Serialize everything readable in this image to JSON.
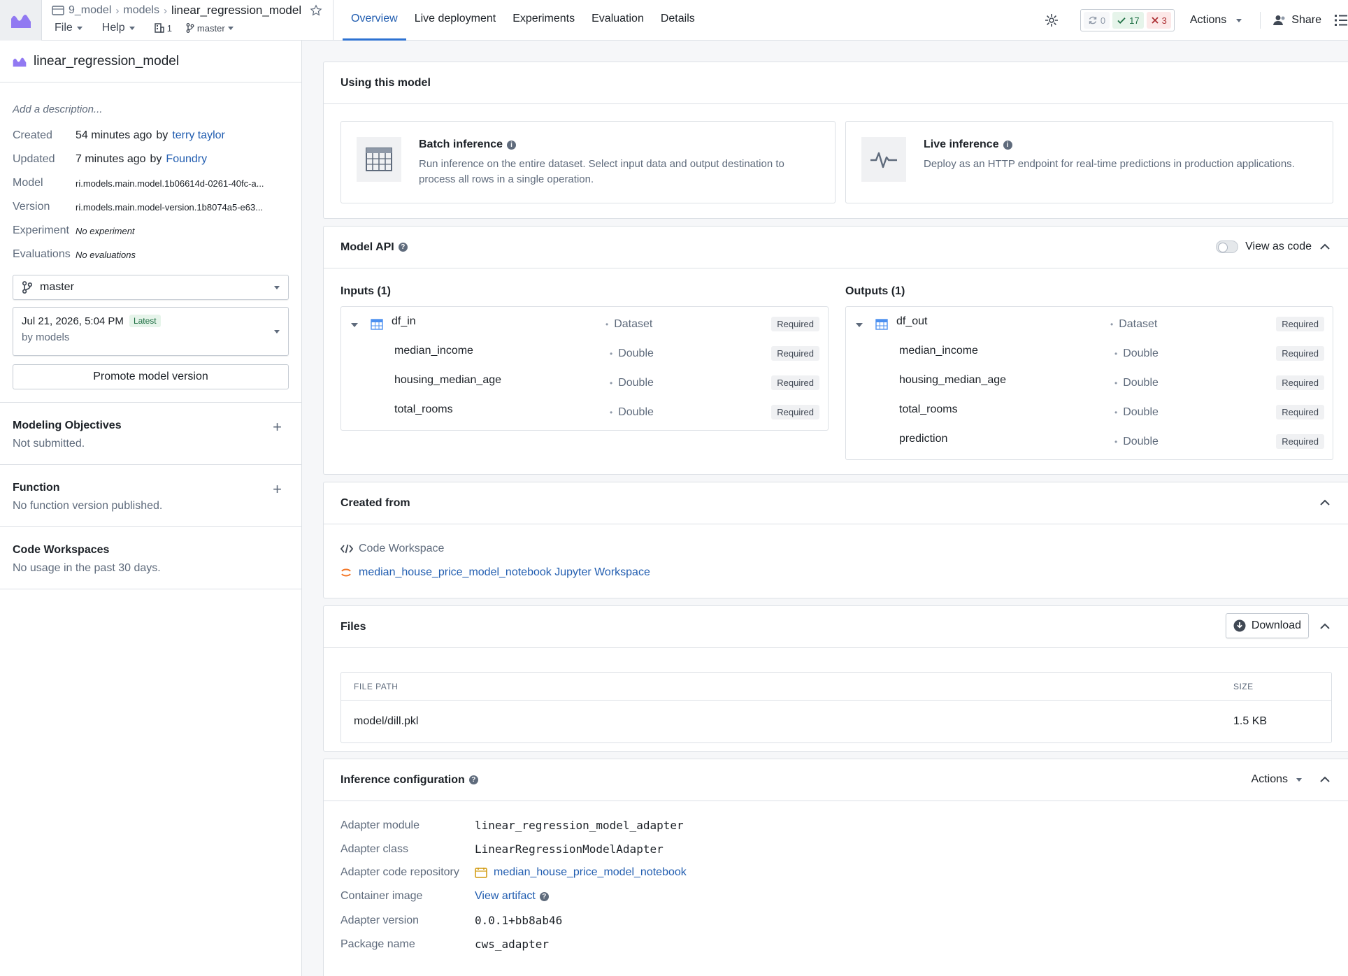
{
  "header": {
    "breadcrumbs": [
      "9_model",
      "models"
    ],
    "current": "linear_regression_model",
    "menus": [
      "File",
      "Help"
    ],
    "folder_count": "1",
    "branch": "master",
    "tabs": [
      "Overview",
      "Live deployment",
      "Experiments",
      "Evaluation",
      "Details"
    ],
    "active_tab": "Overview",
    "counts": {
      "pending": "0",
      "passed": "17",
      "failed": "3"
    },
    "actions_label": "Actions",
    "share_label": "Share"
  },
  "sidebar": {
    "title": "linear_regression_model",
    "description_placeholder": "Add a description...",
    "created": {
      "label": "Created",
      "time": "54 minutes ago",
      "by": "by",
      "user": "terry taylor"
    },
    "updated": {
      "label": "Updated",
      "time": "7 minutes ago",
      "by": "by",
      "user": "Foundry"
    },
    "model": {
      "label": "Model",
      "value": "ri.models.main.model.1b06614d-0261-40fc-a..."
    },
    "version": {
      "label": "Version",
      "value": "ri.models.main.model-version.1b8074a5-e63..."
    },
    "experiment": {
      "label": "Experiment",
      "value": "No experiment"
    },
    "evaluations": {
      "label": "Evaluations",
      "value": "No evaluations"
    },
    "branch_select": "master",
    "version_select": {
      "date": "Jul 21, 2026, 5:04 PM",
      "badge": "Latest",
      "by": "by models"
    },
    "promote_label": "Promote model version",
    "sections": [
      {
        "title": "Modeling Objectives",
        "text": "Not submitted."
      },
      {
        "title": "Function",
        "text": "No function version published."
      },
      {
        "title": "Code Workspaces",
        "text": "No usage in the past 30 days."
      }
    ]
  },
  "using": {
    "title": "Using this model",
    "batch": {
      "title": "Batch inference",
      "desc": "Run inference on the entire dataset. Select input data and output destination to process all rows in a single operation."
    },
    "live": {
      "title": "Live inference",
      "desc": "Deploy as an HTTP endpoint for real-time predictions in production applications."
    }
  },
  "api": {
    "title": "Model API",
    "view_as_code": "View as code",
    "inputs_title": "Inputs (1)",
    "outputs_title": "Outputs (1)",
    "inputs": {
      "dataset": {
        "name": "df_in",
        "type": "Dataset",
        "req": "Required"
      },
      "columns": [
        {
          "name": "median_income",
          "type": "Double",
          "req": "Required"
        },
        {
          "name": "housing_median_age",
          "type": "Double",
          "req": "Required"
        },
        {
          "name": "total_rooms",
          "type": "Double",
          "req": "Required"
        }
      ]
    },
    "outputs": {
      "dataset": {
        "name": "df_out",
        "type": "Dataset",
        "req": "Required"
      },
      "columns": [
        {
          "name": "median_income",
          "type": "Double",
          "req": "Required"
        },
        {
          "name": "housing_median_age",
          "type": "Double",
          "req": "Required"
        },
        {
          "name": "total_rooms",
          "type": "Double",
          "req": "Required"
        },
        {
          "name": "prediction",
          "type": "Double",
          "req": "Required"
        }
      ]
    }
  },
  "created_from": {
    "title": "Created from",
    "source_type": "Code Workspace",
    "link": "median_house_price_model_notebook Jupyter Workspace"
  },
  "files": {
    "title": "Files",
    "download_label": "Download",
    "columns": [
      "FILE PATH",
      "SIZE"
    ],
    "rows": [
      {
        "path": "model/dill.pkl",
        "size": "1.5 KB"
      }
    ]
  },
  "inference": {
    "title": "Inference configuration",
    "actions_label": "Actions",
    "adapter_module": {
      "label": "Adapter module",
      "value": "linear_regression_model_adapter"
    },
    "adapter_class": {
      "label": "Adapter class",
      "value": "LinearRegressionModelAdapter"
    },
    "adapter_repo": {
      "label": "Adapter code repository",
      "value": "median_house_price_model_notebook"
    },
    "container_image": {
      "label": "Container image",
      "value": "View artifact"
    },
    "adapter_version": {
      "label": "Adapter version",
      "value": "0.0.1+bb8ab46"
    },
    "package_name": {
      "label": "Package name",
      "value": "cws_adapter"
    }
  },
  "colors": {
    "accent": "#2d72d2",
    "link": "#215db0",
    "model_icon": "#9179f2"
  }
}
